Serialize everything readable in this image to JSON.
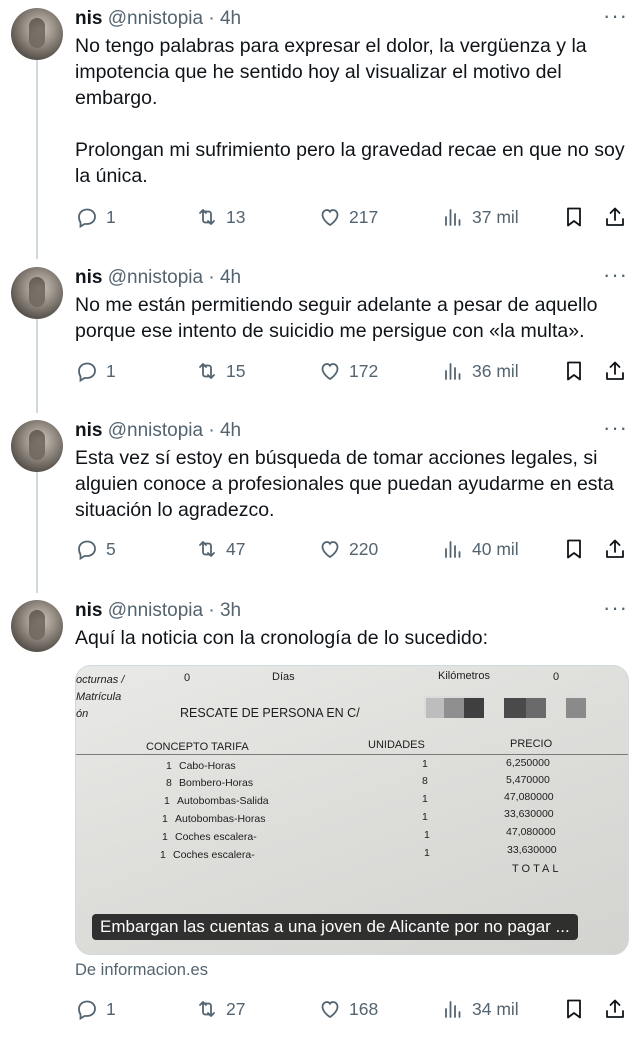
{
  "tweets": [
    {
      "name": "nis",
      "handle": "@nnistopia",
      "time": "· 4h",
      "text": "No tengo palabras para expresar el dolor, la vergüenza y la impotencia que he sentido hoy al visualizar el motivo del embargo.\n\nProlongan mi sufrimiento pero la gravedad recae en que no soy la única.",
      "replies": "1",
      "retweets": "13",
      "likes": "217",
      "views": "37 mil"
    },
    {
      "name": "nis",
      "handle": "@nnistopia",
      "time": "· 4h",
      "text": "No me están permitiendo seguir adelante a pesar de aquello porque ese intento de suicidio me persigue con «la multa».",
      "replies": "1",
      "retweets": "15",
      "likes": "172",
      "views": "36 mil"
    },
    {
      "name": "nis",
      "handle": "@nnistopia",
      "time": "· 4h",
      "text": "Esta vez sí estoy en búsqueda de tomar acciones legales, si alguien conoce a profesionales que puedan ayudarme en esta situación lo agradezco.",
      "replies": "5",
      "retweets": "47",
      "likes": "220",
      "views": "40 mil"
    },
    {
      "name": "nis",
      "handle": "@nnistopia",
      "time": "· 3h",
      "text": "Aquí la noticia con la cronología de lo sucedido:",
      "replies": "1",
      "retweets": "27",
      "likes": "168",
      "views": "34 mil"
    }
  ],
  "more_label": "···",
  "card": {
    "caption": "Embargan las cuentas a una joven de Alicante por no pagar ...",
    "source": "De informacion.es",
    "doc": {
      "top_left": [
        "octurnas /",
        "Matrícula",
        "ón"
      ],
      "zero1": "0",
      "dias": "Días",
      "kilometros": "Kilómetros",
      "zero2": "0",
      "rescate": "RESCATE DE PERSONA EN C/",
      "col_concepto": "CONCEPTO TARIFA",
      "col_unidades": "UNIDADES",
      "col_precio": "PRECIO",
      "rows": [
        {
          "qty": "1",
          "concept": "Cabo-Horas",
          "units": "1",
          "price": "6,250000"
        },
        {
          "qty": "8",
          "concept": "Bombero-Horas",
          "units": "8",
          "price": "5,470000"
        },
        {
          "qty": "1",
          "concept": "Autobombas-Salida",
          "units": "1",
          "price": "47,080000"
        },
        {
          "qty": "1",
          "concept": "Autobombas-Horas",
          "units": "1",
          "price": "33,630000"
        },
        {
          "qty": "1",
          "concept": "Coches escalera-",
          "units": "1",
          "price": "47,080000"
        },
        {
          "qty": "1",
          "concept": "Coches escalera-",
          "units": "1",
          "price": "33,630000"
        }
      ],
      "total": "TOTAL"
    }
  }
}
